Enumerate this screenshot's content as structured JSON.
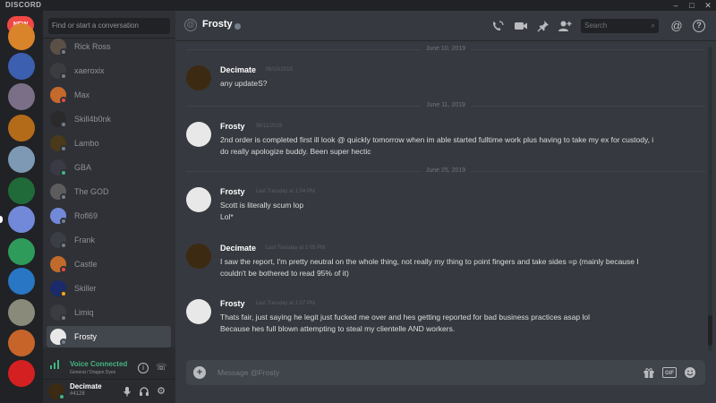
{
  "app": {
    "brand": "DISCORD",
    "new_badge": "NEW"
  },
  "window_controls": {
    "minimize": "–",
    "maximize": "□",
    "close": "✕"
  },
  "guilds": [
    {
      "name": "server-1",
      "color": "#d9832b"
    },
    {
      "name": "server-2",
      "color": "#3d5fb0"
    },
    {
      "name": "server-3",
      "color": "#7a6f86"
    },
    {
      "name": "server-4",
      "color": "#b36b1a"
    },
    {
      "name": "server-5",
      "color": "#7d99b3"
    },
    {
      "name": "server-6",
      "color": "#1f6a38"
    },
    {
      "name": "server-7",
      "color": "#7289da"
    },
    {
      "name": "server-8",
      "color": "#2e9b5a"
    },
    {
      "name": "server-9",
      "color": "#2876c4"
    },
    {
      "name": "server-10",
      "color": "#8a8a7a"
    },
    {
      "name": "server-11",
      "color": "#c6642a"
    },
    {
      "name": "server-12",
      "color": "#d42020"
    },
    {
      "name": "server-13",
      "color": "#c02a2a"
    }
  ],
  "dm_search": {
    "placeholder": "Find or start a conversation"
  },
  "dms": [
    {
      "name": "Rick Ross",
      "status_color": "#747f8d",
      "avatar_color": "#5a5046"
    },
    {
      "name": "xaeroxix",
      "status_color": "#747f8d",
      "avatar_color": "#3a3c40"
    },
    {
      "name": "Max",
      "status_color": "#f04747",
      "avatar_color": "#c46a2c"
    },
    {
      "name": "Skill4b0nk",
      "status_color": "#747f8d",
      "avatar_color": "#2a2a2a"
    },
    {
      "name": "Lambo",
      "status_color": "#747f8d",
      "avatar_color": "#4a3a1a"
    },
    {
      "name": "GBA",
      "status_color": "#43b581",
      "avatar_color": "#3a3a44"
    },
    {
      "name": "The GOD",
      "status_color": "#747f8d",
      "avatar_color": "#5c5c5c"
    },
    {
      "name": "Rofl69",
      "status_color": "#747f8d",
      "avatar_color": "#7289da"
    },
    {
      "name": "Frank",
      "status_color": "#747f8d",
      "avatar_color": "#3b3e45"
    },
    {
      "name": "Castle",
      "status_color": "#f04747",
      "avatar_color": "#c06a2c"
    },
    {
      "name": "Skiller",
      "status_color": "#faa61a",
      "avatar_color": "#1a2a6a"
    },
    {
      "name": "Limiq",
      "status_color": "#747f8d",
      "avatar_color": "#3a3c42"
    },
    {
      "name": "Frosty",
      "status_color": "#747f8d",
      "avatar_color": "#e8e8e8"
    }
  ],
  "voice": {
    "status": "Voice Connected",
    "channel": "General / Dragon Dyes"
  },
  "user": {
    "name": "Decimate",
    "tag": "#4128"
  },
  "channel": {
    "name": "Frosty",
    "search_placeholder": "Search"
  },
  "messages": [
    {
      "type": "divider",
      "date": "June 10, 2019"
    },
    {
      "type": "message",
      "author": "Decimate",
      "timestamp": "06/10/2019",
      "avatar_color": "#3d2a12",
      "lines": [
        "any updateS?"
      ]
    },
    {
      "type": "divider",
      "date": "June 11, 2019"
    },
    {
      "type": "message",
      "author": "Frosty",
      "timestamp": "06/11/2019",
      "avatar_color": "#e8e8e8",
      "lines": [
        "2nd order is completed first ill look @ quickly tomorrow when im able started fulltime work plus having to take my ex for custody, i",
        "do really apologize buddy. Been super hectic"
      ]
    },
    {
      "type": "divider",
      "date": "June 25, 2019"
    },
    {
      "type": "message",
      "author": "Frosty",
      "timestamp": "Last Tuesday at 1:04 PM",
      "avatar_color": "#e8e8e8",
      "lines": [
        "Scott is literally scum lop",
        "Lol*"
      ]
    },
    {
      "type": "message",
      "author": "Decimate",
      "timestamp": "Last Tuesday at 1:05 PM",
      "avatar_color": "#3d2a12",
      "lines": [
        "I saw the report, I'm pretty neutral on the whole thing, not really my thing to point fingers and take sides =p (mainly because I",
        "couldn't be bothered to read 95% of it)"
      ]
    },
    {
      "type": "message",
      "author": "Frosty",
      "timestamp": "Last Tuesday at 1:07 PM",
      "avatar_color": "#e8e8e8",
      "lines": [
        "Thats fair, just saying he legit just fucked me over and hes getting reported for bad business practices asap lol",
        "Because hes full blown attempting to steal my clientelle AND workers."
      ]
    }
  ],
  "composer": {
    "placeholder": "Message @Frosty",
    "gif_label": "GIF"
  },
  "colors": {
    "online": "#43b581",
    "dnd": "#f04747",
    "idle": "#faa61a",
    "offline": "#747f8d",
    "background": "#36393f",
    "sidebar": "#2f3136",
    "guild_bar": "#202225"
  }
}
